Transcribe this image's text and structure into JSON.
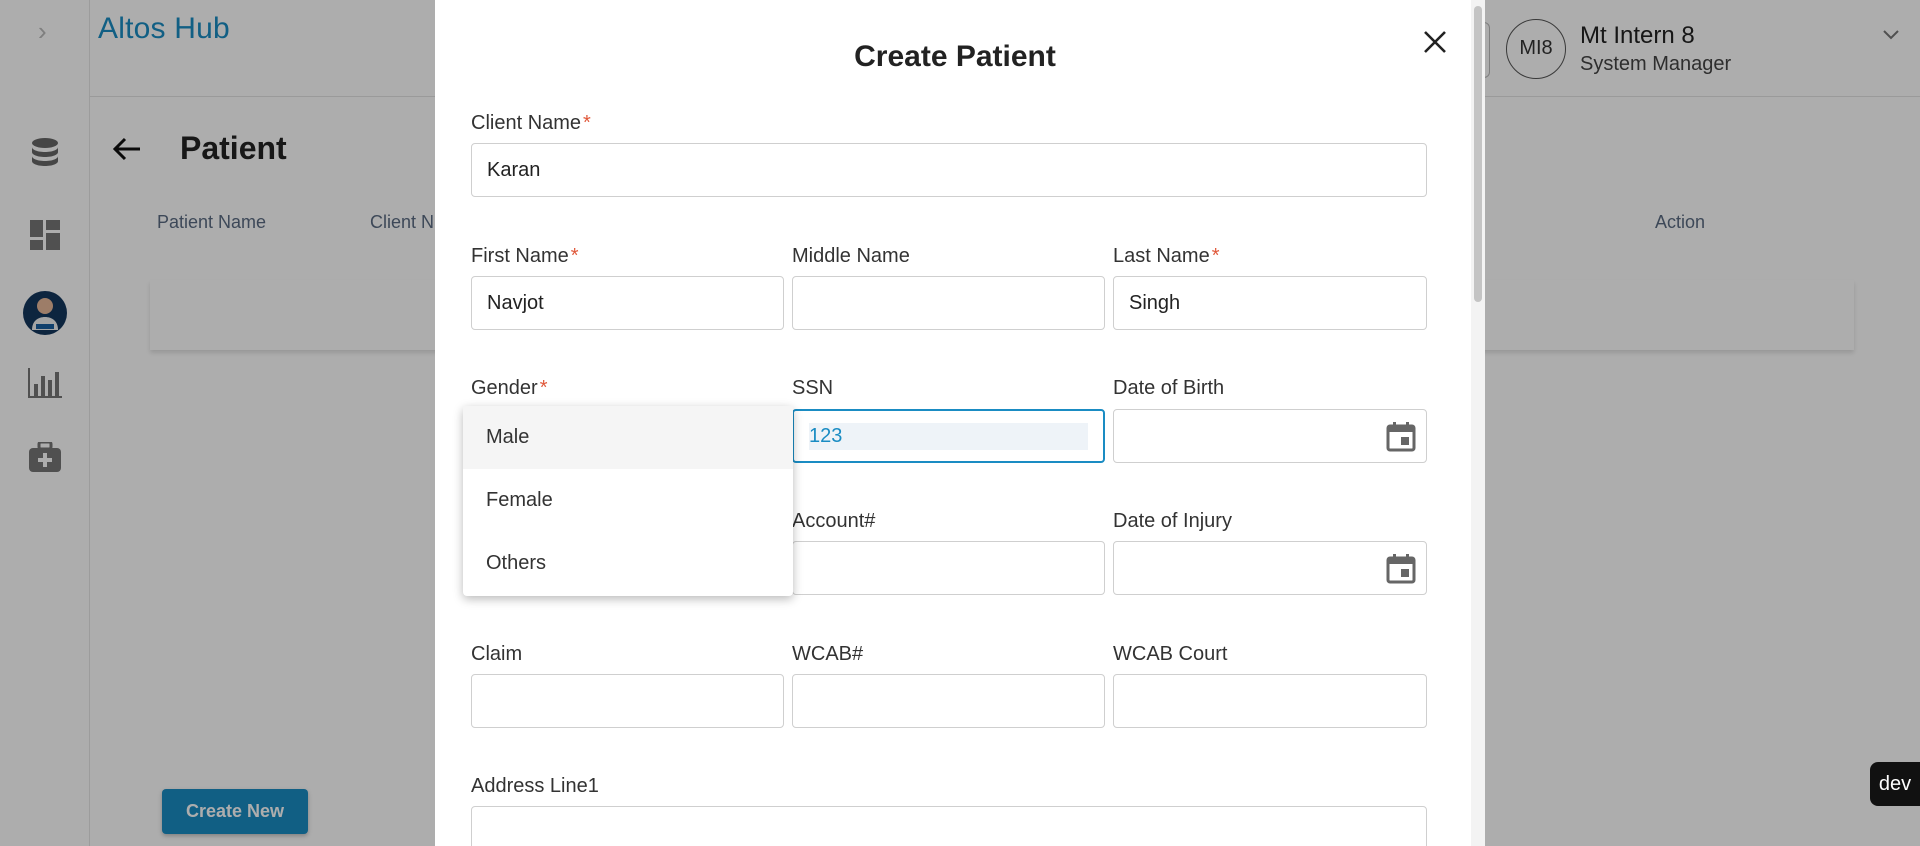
{
  "app": {
    "brand": "Altos Hub"
  },
  "header": {
    "user_initials": "MI8",
    "user_name": "Mt Intern 8",
    "user_role": "System Manager"
  },
  "page": {
    "title": "Patient",
    "columns": [
      "Patient Name",
      "Client N",
      "Action"
    ],
    "create_new_label": "Create New"
  },
  "env_badge": "dev",
  "modal": {
    "title": "Create Patient",
    "fields": {
      "client_name": {
        "label": "Client Name",
        "value": "Karan",
        "required": "*"
      },
      "first_name": {
        "label": "First Name",
        "value": "Navjot",
        "required": "*"
      },
      "middle_name": {
        "label": "Middle Name",
        "value": ""
      },
      "last_name": {
        "label": "Last Name",
        "value": "Singh",
        "required": "*"
      },
      "gender": {
        "label": "Gender",
        "required": "*"
      },
      "ssn": {
        "label": "SSN",
        "value": "123"
      },
      "date_of_birth": {
        "label": "Date of Birth",
        "value": ""
      },
      "account": {
        "label": "Account#",
        "value": ""
      },
      "date_of_injury": {
        "label": "Date of Injury",
        "value": ""
      },
      "claim": {
        "label": "Claim",
        "value": ""
      },
      "wcab": {
        "label": "WCAB#",
        "value": ""
      },
      "wcab_court": {
        "label": "WCAB Court",
        "value": ""
      },
      "address_line1": {
        "label": "Address Line1",
        "value": ""
      }
    },
    "gender_options": [
      "Male",
      "Female",
      "Others"
    ],
    "gender_highlighted": "Male"
  },
  "icons": [
    "chevron-right-icon",
    "database-icon",
    "dashboard-icon",
    "doctor-avatar-icon",
    "bar-chart-icon",
    "medical-kit-icon",
    "arrow-left-icon",
    "close-icon",
    "calendar-icon",
    "chevron-down-icon"
  ],
  "colors": {
    "brand": "#1a8cc3",
    "required": "#e0583a",
    "overlay": "rgba(0,0,0,0.32)"
  }
}
